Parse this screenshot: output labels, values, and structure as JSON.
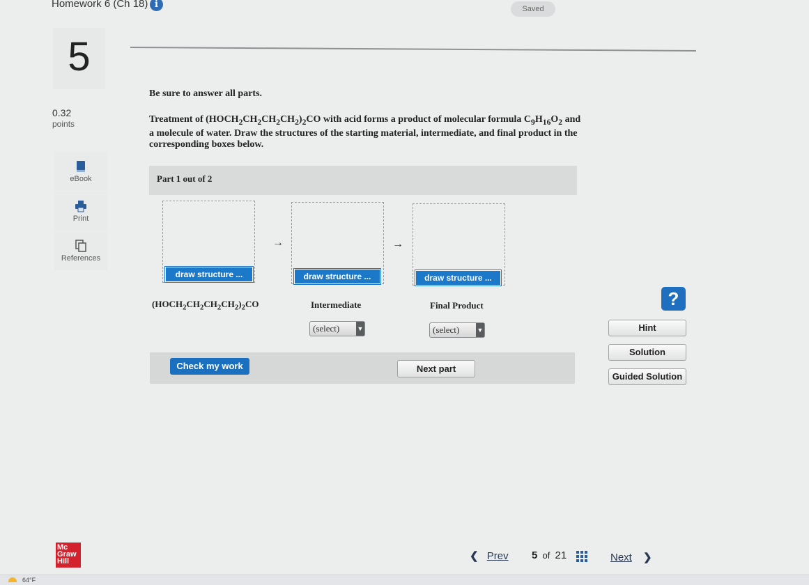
{
  "header": {
    "title": "Homework 6 (Ch 18)",
    "info_glyph": "i",
    "status": "Saved"
  },
  "question": {
    "number": "5",
    "points_value": "0.32",
    "points_label": "points"
  },
  "sidebar": {
    "items": [
      {
        "label": "eBook",
        "icon": "book-icon"
      },
      {
        "label": "Print",
        "icon": "printer-icon"
      },
      {
        "label": "References",
        "icon": "references-icon"
      }
    ]
  },
  "content": {
    "instruction": "Be sure to answer all parts.",
    "problem": {
      "p1": "Treatment of (HOCH",
      "s1": "2",
      "p2": "CH",
      "s2": "2",
      "p3": "CH",
      "s3": "2",
      "p4": "CH",
      "s4": "2",
      "p5": ")",
      "s5": "2",
      "p6": "CO with acid forms a product of molecular formula C",
      "s6": "9",
      "p7": "H",
      "s7": "16",
      "p8": "O",
      "s8": "2",
      "p9": " and a molecule of water. Draw the structures of the starting material, intermediate, and final product in the corresponding boxes below."
    },
    "part_label": "Part 1 out of 2",
    "draw_label": "draw structure ...",
    "arrow": "→",
    "start_label": {
      "a": "(HOCH",
      "b": "2",
      "c": "CH",
      "d": "2",
      "e": "CH",
      "f": "2",
      "g": "CH",
      "h": "2",
      "i": ")",
      "j": "2",
      "k": "CO"
    },
    "intermediate_label": "Intermediate",
    "final_label": "Final Product",
    "select_value": "(select)",
    "check_label": "Check my work",
    "next_part_label": "Next part"
  },
  "aux": {
    "help_glyph": "?",
    "hint": "Hint",
    "solution": "Solution",
    "guided": "Guided Solution"
  },
  "footer": {
    "logo_lines": [
      "Mc",
      "Graw",
      "Hill"
    ],
    "prev": "Prev",
    "page_current": "5",
    "page_of": "of",
    "page_total": "21",
    "next": "Next",
    "prev_glyph": "❮",
    "next_glyph": "❯"
  },
  "taskbar": {
    "temperature": "64°F"
  },
  "colors": {
    "accent_blue": "#1c78c9",
    "brand_red": "#d3212d"
  }
}
